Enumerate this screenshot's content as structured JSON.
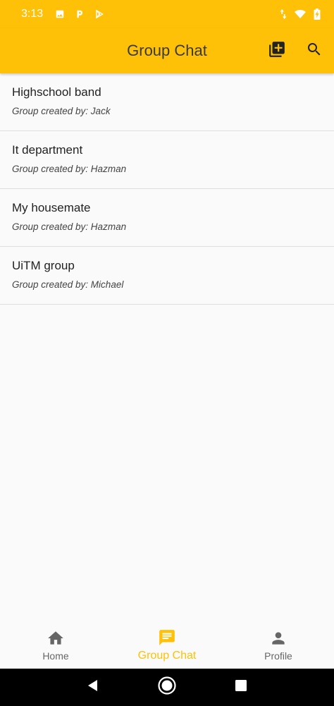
{
  "status_bar": {
    "time": "3:13",
    "icons": [
      "image-icon",
      "parking-icon",
      "play-store-icon",
      "data-arrows-icon",
      "wifi-icon",
      "battery-charging-icon"
    ]
  },
  "app_bar": {
    "title": "Group Chat",
    "background_color": "#ffc107",
    "actions": [
      "add-group-icon",
      "search-icon"
    ]
  },
  "groups": [
    {
      "name": "Highschool band",
      "creator": "Group created by: Jack"
    },
    {
      "name": "It department",
      "creator": "Group created by: Hazman"
    },
    {
      "name": "My housemate",
      "creator": "Group created by: Hazman"
    },
    {
      "name": "UiTM group",
      "creator": "Group created by: Michael"
    }
  ],
  "bottom_nav": {
    "items": [
      {
        "label": "Home",
        "icon": "home-icon",
        "active": false
      },
      {
        "label": "Group Chat",
        "icon": "chat-icon",
        "active": true
      },
      {
        "label": "Profile",
        "icon": "person-icon",
        "active": false
      }
    ],
    "active_color": "#ffc107",
    "inactive_color": "#666666"
  },
  "system_nav": {
    "buttons": [
      "back-icon",
      "home-circle-icon",
      "recents-icon"
    ]
  }
}
